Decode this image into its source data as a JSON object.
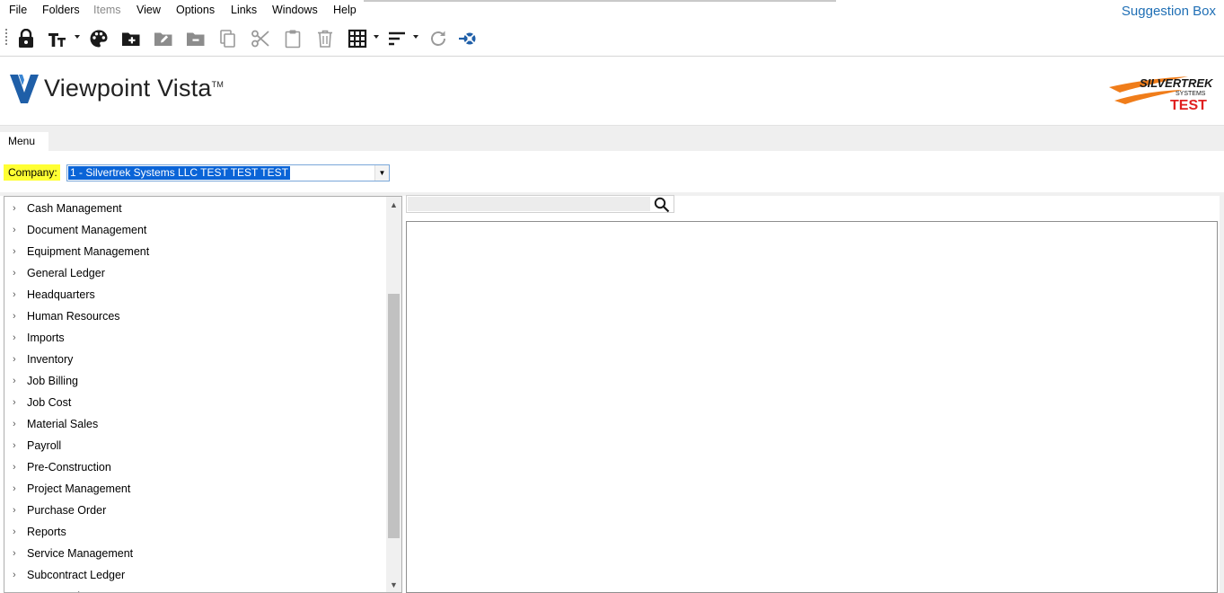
{
  "menubar": {
    "items": [
      {
        "label": "File",
        "enabled": true
      },
      {
        "label": "Folders",
        "enabled": true
      },
      {
        "label": "Items",
        "enabled": false
      },
      {
        "label": "View",
        "enabled": true
      },
      {
        "label": "Options",
        "enabled": true
      },
      {
        "label": "Links",
        "enabled": true
      },
      {
        "label": "Windows",
        "enabled": true
      },
      {
        "label": "Help",
        "enabled": true
      }
    ],
    "suggestion_box": "Suggestion Box"
  },
  "toolbar": {
    "buttons": [
      "lock-icon",
      "text-size-icon",
      "palette-icon",
      "new-folder-icon",
      "rename-folder-icon",
      "remove-folder-icon",
      "copy-icon",
      "cut-icon",
      "paste-icon",
      "delete-icon",
      "grid-icon",
      "sort-icon",
      "refresh-icon",
      "help-launch-icon"
    ]
  },
  "header": {
    "product_name": "Viewpoint Vista",
    "trademark": "TM",
    "brand_logo": {
      "line1": "SILVERTREK",
      "line2": "SYSTEMS",
      "line3": "TEST"
    },
    "colors": {
      "brand_blue": "#1f5fa8",
      "brand_orange": "#f07d1a",
      "brand_red": "#e02020"
    }
  },
  "tabs": {
    "menu": "Menu"
  },
  "company": {
    "label": "Company:",
    "selected": "1 - Silvertrek Systems LLC TEST TEST TEST"
  },
  "modules": [
    "Cash Management",
    "Document Management",
    "Equipment Management",
    "General Ledger",
    "Headquarters",
    "Human Resources",
    "Imports",
    "Inventory",
    "Job Billing",
    "Job Cost",
    "Material Sales",
    "Payroll",
    "Pre-Construction",
    "Project Management",
    "Purchase Order",
    "Reports",
    "Service Management",
    "Subcontract Ledger",
    "User Database"
  ],
  "search": {
    "value": ""
  }
}
